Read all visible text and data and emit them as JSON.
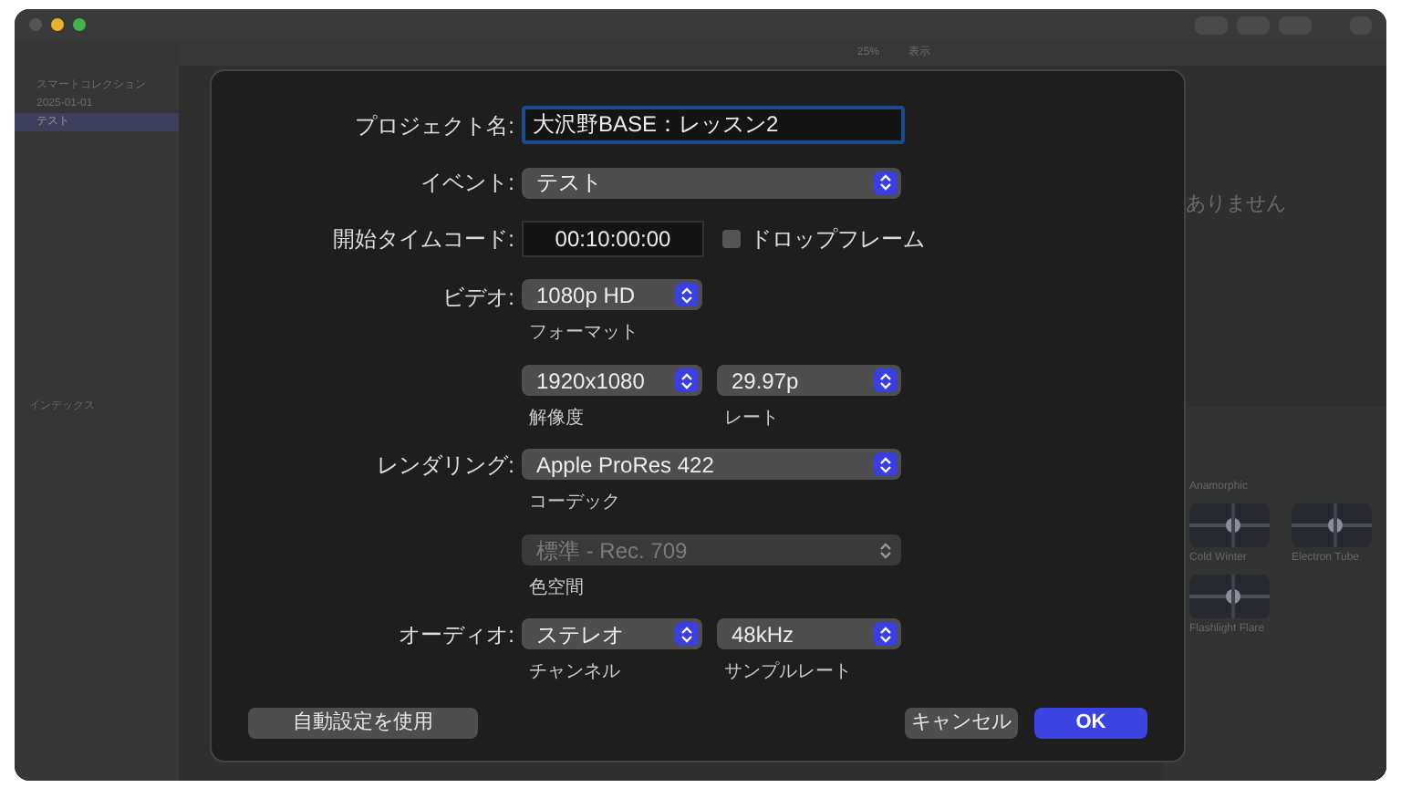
{
  "sidebar": {
    "items": [
      {
        "label": "スマートコレクション",
        "selected": false
      },
      {
        "label": "2025-01-01",
        "selected": false
      },
      {
        "label": "テスト",
        "selected": true
      }
    ]
  },
  "viewer": {
    "zoom": "25%",
    "view_menu": "表示",
    "message": "ありません"
  },
  "index_button": "インデックス",
  "effects": {
    "category": "Anamorphic",
    "items": [
      {
        "name": "Cold Winter"
      },
      {
        "name": "Electron Tube"
      },
      {
        "name": "Flashlight Flare"
      }
    ]
  },
  "dialog": {
    "project_name": {
      "label": "プロジェクト名:",
      "value": "大沢野BASE：レッスン2"
    },
    "event": {
      "label": "イベント:",
      "value": "テスト",
      "disabled": false
    },
    "timecode": {
      "label": "開始タイムコード:",
      "value": "00:10:00:00"
    },
    "drop_frame": {
      "label": "ドロップフレーム",
      "checked": false
    },
    "video": {
      "label": "ビデオ:",
      "format": {
        "value": "1080p HD",
        "caption": "フォーマット",
        "disabled": false
      },
      "resolution": {
        "value": "1920x1080",
        "caption": "解像度",
        "disabled": false
      },
      "rate": {
        "value": "29.97p",
        "caption": "レート",
        "disabled": false
      }
    },
    "rendering": {
      "label": "レンダリング:",
      "codec": {
        "value": "Apple ProRes 422",
        "caption": "コーデック",
        "disabled": false
      },
      "color_space": {
        "value": "標準 - Rec. 709",
        "caption": "色空間",
        "disabled": true
      }
    },
    "audio": {
      "label": "オーディオ:",
      "channels": {
        "value": "ステレオ",
        "caption": "チャンネル",
        "disabled": false
      },
      "sample_rate": {
        "value": "48kHz",
        "caption": "サンプルレート",
        "disabled": false
      }
    },
    "buttons": [
      {
        "label": "自動設定を使用",
        "kind": "secondary"
      },
      {
        "label": "キャンセル",
        "kind": "secondary"
      },
      {
        "label": "OK",
        "kind": "default"
      }
    ]
  }
}
